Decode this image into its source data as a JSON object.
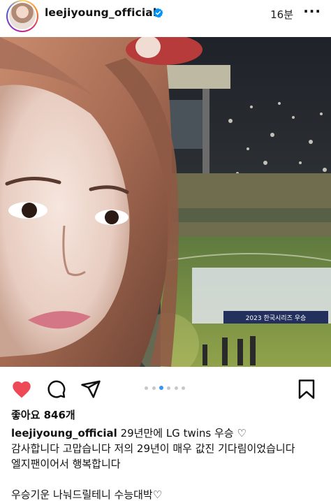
{
  "post": {
    "username": "leejiyoung_official",
    "time_ago": "16분",
    "verified_icon": "verified-badge-icon",
    "more_icon": "more-options-icon",
    "image": {
      "subject": "selfie-at-stadium",
      "banner_text": "2023 한국시리즈 우승"
    },
    "carousel": {
      "total": 6,
      "active_index": 2
    },
    "actions": {
      "like_icon": "heart-filled-icon",
      "comment_icon": "comment-icon",
      "share_icon": "send-icon",
      "save_icon": "bookmark-icon",
      "like_color": "#ed4956"
    },
    "likes": "좋아요 846개",
    "caption": {
      "username": "leejiyoung_official",
      "lines": [
        "29년만에 LG twins 우승 ♡",
        "감사합니다 고맙습니다 저의 29년이 매우 값진 기다림이었습니다",
        "엘지팬이어서 행복합니다",
        "",
        "우승기운 나눠드릴테니 수능대박♡"
      ]
    }
  }
}
